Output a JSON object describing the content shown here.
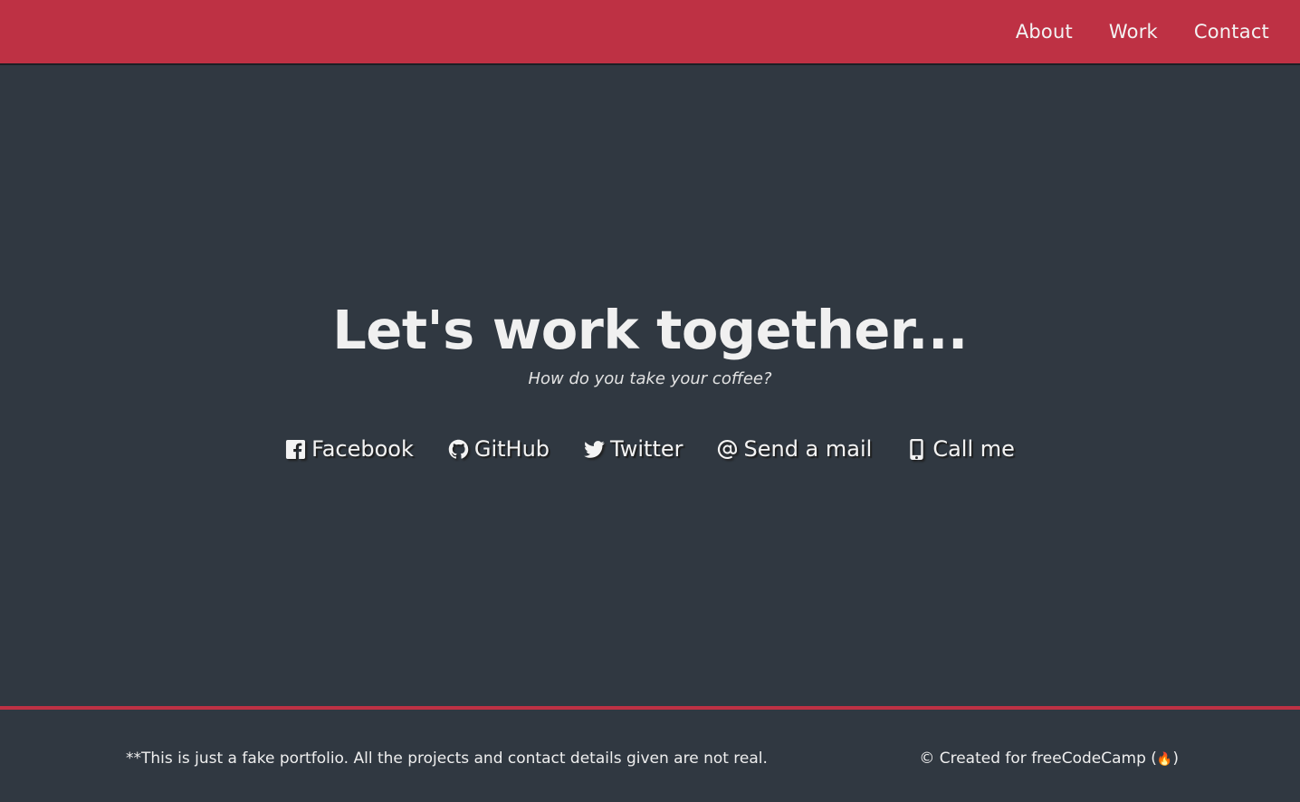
{
  "navbar": {
    "items": [
      {
        "label": "About"
      },
      {
        "label": "Work"
      },
      {
        "label": "Contact"
      }
    ]
  },
  "contact": {
    "title": "Let's work together...",
    "subtitle": "How do you take your coffee?",
    "links": [
      {
        "label": "Facebook",
        "icon": "facebook-icon"
      },
      {
        "label": "GitHub",
        "icon": "github-icon"
      },
      {
        "label": "Twitter",
        "icon": "twitter-icon"
      },
      {
        "label": "Send a mail",
        "icon": "at-icon"
      },
      {
        "label": "Call me",
        "icon": "mobile-phone-icon"
      }
    ]
  },
  "footer": {
    "note": "**This is just a fake portfolio. All the projects and contact details given are not real.",
    "credit_prefix": "© Created for freeCodeCamp (",
    "credit_suffix": ")"
  },
  "colors": {
    "accent": "#be3144",
    "background": "#303841",
    "text": "#f0f0f0"
  }
}
